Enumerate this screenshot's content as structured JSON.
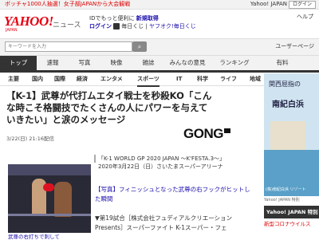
{
  "topbar": {
    "promo": "ボッチャ1000人抽選！女子部JAPANから大会観戦",
    "yahoo_japan_link": "Yahoo! JAPAN",
    "login_button": "ログイン"
  },
  "header": {
    "logo_main": "YAHOO!",
    "logo_sub": "JAPAN",
    "section": "ニュース",
    "promo_line1": "IDでもっと便利に",
    "promo_line1_link": "新規取得",
    "promo_line2_link": "ログイン",
    "promo_line3": "毎日くじ",
    "promo_line3_link": "ヤフオク!毎日くじ",
    "help": "ヘルプ"
  },
  "search": {
    "placeholder": "キーワードを入力",
    "button_icon": "search-icon",
    "user_info": "ユーザーページ"
  },
  "nav1": {
    "tabs": [
      "トップ",
      "速報",
      "写真",
      "映像",
      "雑誌",
      "みんなの意見",
      "ランキング",
      "有料"
    ],
    "active": 0
  },
  "nav2": {
    "tabs": [
      "主要",
      "国内",
      "国際",
      "経済",
      "エンタメ",
      "スポーツ",
      "IT",
      "科学",
      "ライフ",
      "地域"
    ],
    "active": 5
  },
  "article": {
    "headline": "【K-1】武尊が代打ムエタイ戦士を秒殺KO「こんな時こそ格闘技でたくさんの人にパワーを与えていきたい」と涙のメッセージ",
    "dateline": "3/22(日) 21:16配信",
    "source_logo": "GONG",
    "event_quote": "「K-1 WORLD GP 2020 JAPAN ～K'FESTA.3～」",
    "event_date": "2020年3月22日（日）さいたまスーパーアリーナ",
    "photo_link": "【写真】フィニッシュとなった武尊の右フックがヒットした瞬間",
    "body": "▼第19試合［株式会社フュディアルクリエーション Presents］スーパーファイト K-1スーパー・フェ",
    "photo_caption": "武尊の右打ちで刺して"
  },
  "sidebar": {
    "ad_text1": "関西屈指の",
    "ad_text2": "南紀白浜",
    "ad_caption": "(株)南紀白浜 リゾート",
    "ad_label": "Yahoo! JAPAN 特別",
    "special_header": "Yahoo! JAPAN 特別企画",
    "special_item": "新型コロナウイルス"
  }
}
